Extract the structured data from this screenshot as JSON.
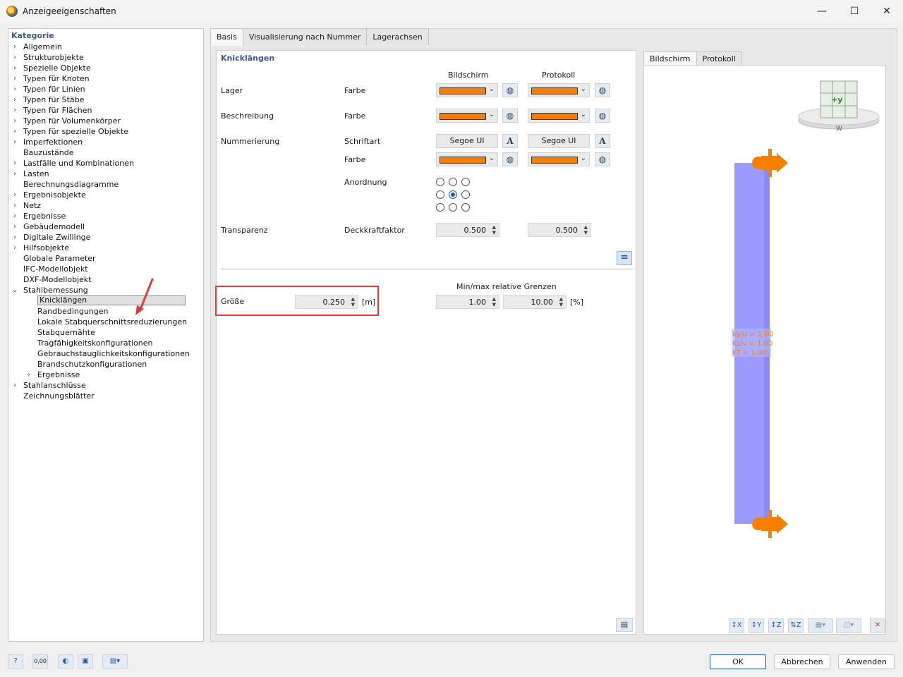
{
  "window": {
    "title": "Anzeigeeigenschaften",
    "minimize": "—",
    "maximize": "☐",
    "close": "✕"
  },
  "left": {
    "header": "Kategorie",
    "items": [
      {
        "label": "Allgemein",
        "level": 0,
        "chev": "›"
      },
      {
        "label": "Strukturobjekte",
        "level": 0,
        "chev": "›"
      },
      {
        "label": "Spezielle Objekte",
        "level": 0,
        "chev": "›"
      },
      {
        "label": "Typen für Knoten",
        "level": 0,
        "chev": "›"
      },
      {
        "label": "Typen für Linien",
        "level": 0,
        "chev": "›"
      },
      {
        "label": "Typen für Stäbe",
        "level": 0,
        "chev": "›"
      },
      {
        "label": "Typen für Flächen",
        "level": 0,
        "chev": "›"
      },
      {
        "label": "Typen für Volumenkörper",
        "level": 0,
        "chev": "›"
      },
      {
        "label": "Typen für spezielle Objekte",
        "level": 0,
        "chev": "›"
      },
      {
        "label": "Imperfektionen",
        "level": 0,
        "chev": "›"
      },
      {
        "label": "Bauzustände",
        "level": 0,
        "chev": ""
      },
      {
        "label": "Lastfälle und Kombinationen",
        "level": 0,
        "chev": "›"
      },
      {
        "label": "Lasten",
        "level": 0,
        "chev": "›"
      },
      {
        "label": "Berechnungsdiagramme",
        "level": 0,
        "chev": ""
      },
      {
        "label": "Ergebnisobjekte",
        "level": 0,
        "chev": "›"
      },
      {
        "label": "Netz",
        "level": 0,
        "chev": "›"
      },
      {
        "label": "Ergebnisse",
        "level": 0,
        "chev": "›"
      },
      {
        "label": "Gebäudemodell",
        "level": 0,
        "chev": "›"
      },
      {
        "label": "Digitale Zwillinge",
        "level": 0,
        "chev": "›"
      },
      {
        "label": "Hilfsobjekte",
        "level": 0,
        "chev": "›"
      },
      {
        "label": "Globale Parameter",
        "level": 0,
        "chev": ""
      },
      {
        "label": "IFC-Modellobjekt",
        "level": 0,
        "chev": ""
      },
      {
        "label": "DXF-Modellobjekt",
        "level": 0,
        "chev": ""
      },
      {
        "label": "Stahlbemessung",
        "level": 0,
        "chev": "⌄"
      },
      {
        "label": "Knicklängen",
        "level": 1,
        "chev": "",
        "selected": true
      },
      {
        "label": "Randbedingungen",
        "level": 1,
        "chev": ""
      },
      {
        "label": "Lokale Stabquerschnittsreduzierungen",
        "level": 1,
        "chev": ""
      },
      {
        "label": "Stabquernähte",
        "level": 1,
        "chev": ""
      },
      {
        "label": "Tragfähigkeitskonfigurationen",
        "level": 1,
        "chev": ""
      },
      {
        "label": "Gebrauchstauglichkeitskonfigurationen",
        "level": 1,
        "chev": ""
      },
      {
        "label": "Brandschutzkonfigurationen",
        "level": 1,
        "chev": ""
      },
      {
        "label": "Ergebnisse",
        "level": 1,
        "chev": "›"
      },
      {
        "label": "Stahlanschlüsse",
        "level": 0,
        "chev": "›"
      },
      {
        "label": "Zeichnungsblätter",
        "level": 0,
        "chev": ""
      }
    ]
  },
  "tabs": [
    "Basis",
    "Visualisierung nach Nummer",
    "Lagerachsen"
  ],
  "panel": {
    "title": "Knicklängen",
    "col_screen": "Bildschirm",
    "col_protocol": "Protokoll",
    "rows": {
      "lager": "Lager",
      "beschreibung": "Beschreibung",
      "nummerierung": "Nummerierung",
      "transparenz": "Transparenz"
    },
    "props": {
      "farbe": "Farbe",
      "schriftart": "Schriftart",
      "anordnung": "Anordnung",
      "deckkraft": "Deckkraftfaktor"
    },
    "font_value": "Segoe UI",
    "opacity_screen": "0.500",
    "opacity_protocol": "0.500",
    "groesse_label": "Größe",
    "groesse_value": "0.250",
    "groesse_unit": "[m]",
    "minmax_label": "Min/max relative Grenzen",
    "min_value": "1.00",
    "max_value": "10.00",
    "minmax_unit": "[%]",
    "accent_color": "#f77f00"
  },
  "preview": {
    "tabs": [
      "Bildschirm",
      "Protokoll"
    ],
    "cube_label": "+y",
    "compass_label": "W",
    "labels": [
      "ky/u = 1.00",
      "kz/v = 1.00",
      "kT = 1.00"
    ],
    "member_color": "#9a9aff"
  },
  "footer": {
    "ok": "OK",
    "cancel": "Abbrechen",
    "apply": "Anwenden",
    "units_icon_text": "0,00"
  }
}
